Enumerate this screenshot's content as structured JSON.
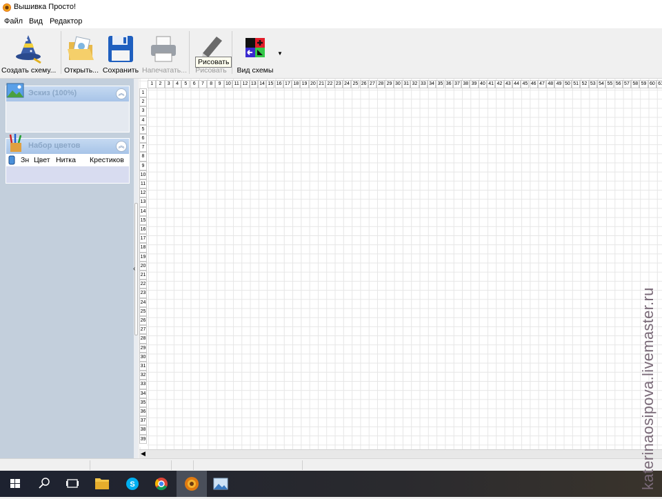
{
  "window": {
    "title": "Вышивка Просто!"
  },
  "menu": {
    "file": "Файл",
    "view": "Вид",
    "editor": "Редактор"
  },
  "toolbar": {
    "create": "Создать схему...",
    "open": "Открыть...",
    "save": "Сохранить",
    "print": "Напечатать...",
    "draw": "Рисовать",
    "scheme_view": "Вид схемы"
  },
  "tooltip": "Рисовать",
  "sketch_panel": {
    "title": "Эскиз (100%)"
  },
  "colors_panel": {
    "title": "Набор цветов",
    "columns": [
      "Зн",
      "Цвет",
      "Нитка",
      "Крестиков"
    ]
  },
  "grid": {
    "columns_visible": 61,
    "rows_visible": 39
  },
  "watermark": "katerinaosipova.livemaster.ru",
  "taskbar": {
    "icons": [
      "windows-start-icon",
      "search-icon",
      "task-view-icon",
      "file-explorer-icon",
      "skype-icon",
      "chrome-icon",
      "embroidery-app-icon",
      "image-viewer-icon"
    ]
  },
  "colors": {
    "accent": "#a7c4e8",
    "panel_bg": "#c3cfdc",
    "grid_line": "#e6e6e6"
  }
}
